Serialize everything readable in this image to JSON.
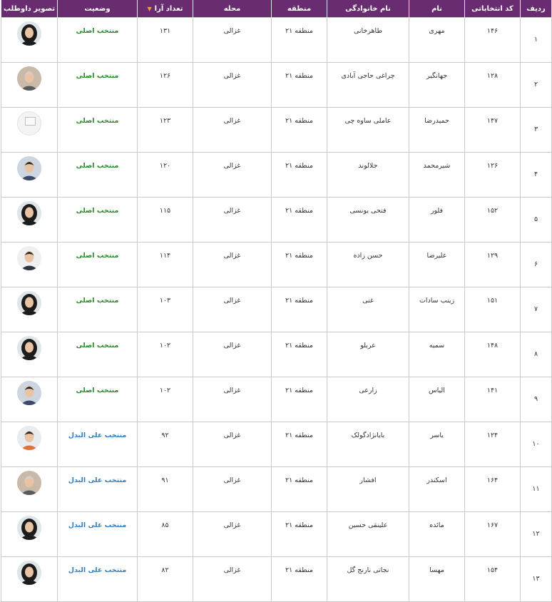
{
  "headers": {
    "radif": "ردیف",
    "code": "کد انتخاباتی",
    "name": "نام",
    "family": "نام خانوادگی",
    "region": "منطقه",
    "mahalle": "محله",
    "votes": "تعداد آرا",
    "status": "وضعیت",
    "photo": "تصویر داوطلب"
  },
  "sort_icon": "sort-down-arrow-icon",
  "colors": {
    "header_bg": "#6a2c70",
    "status_main": "#2b8a2b",
    "status_alt": "#2f7fc2"
  },
  "rows": [
    {
      "radif": "۱",
      "code": "۱۴۶",
      "name": "مهری",
      "family": "طاهرخانی",
      "region": "منطقه ۲۱",
      "mahalle": "غزالی",
      "votes": "۱۳۱",
      "status": "منتخب اصلی",
      "status_type": "main",
      "photo": "woman-hijab-avatar"
    },
    {
      "radif": "۲",
      "code": "۱۲۸",
      "name": "جهانگیر",
      "family": "چراغی حاجی آبادی",
      "region": "منطقه ۲۱",
      "mahalle": "غزالی",
      "votes": "۱۲۶",
      "status": "منتخب اصلی",
      "status_type": "main",
      "photo": "elderly-man-avatar"
    },
    {
      "radif": "۳",
      "code": "۱۴۷",
      "name": "حمیدرضا",
      "family": "عاملی ساوه چی",
      "region": "منطقه ۲۱",
      "mahalle": "غزالی",
      "votes": "۱۲۳",
      "status": "منتخب اصلی",
      "status_type": "main",
      "photo": "no-photo-placeholder"
    },
    {
      "radif": "۴",
      "code": "۱۲۶",
      "name": "شیرمحمد",
      "family": "جلالوند",
      "region": "منطقه ۲۱",
      "mahalle": "غزالی",
      "votes": "۱۲۰",
      "status": "منتخب اصلی",
      "status_type": "main",
      "photo": "man-avatar"
    },
    {
      "radif": "۵",
      "code": "۱۵۲",
      "name": "فلور",
      "family": "فتحی یونسی",
      "region": "منطقه ۲۱",
      "mahalle": "غزالی",
      "votes": "۱۱۵",
      "status": "منتخب اصلی",
      "status_type": "main",
      "photo": "woman-hijab-avatar"
    },
    {
      "radif": "۶",
      "code": "۱۲۹",
      "name": "علیرضا",
      "family": "حسن زاده",
      "region": "منطقه ۲۱",
      "mahalle": "غزالی",
      "votes": "۱۱۴",
      "status": "منتخب اصلی",
      "status_type": "main",
      "photo": "man-suit-avatar"
    },
    {
      "radif": "۷",
      "code": "۱۵۱",
      "name": "زینب سادات",
      "family": "غنی",
      "region": "منطقه ۲۱",
      "mahalle": "غزالی",
      "votes": "۱۰۳",
      "status": "منتخب اصلی",
      "status_type": "main",
      "photo": "woman-scarf-avatar"
    },
    {
      "radif": "۸",
      "code": "۱۴۸",
      "name": "سمیه",
      "family": "عربلو",
      "region": "منطقه ۲۱",
      "mahalle": "غزالی",
      "votes": "۱۰۲",
      "status": "منتخب اصلی",
      "status_type": "main",
      "photo": "woman-chador-avatar"
    },
    {
      "radif": "۹",
      "code": "۱۴۱",
      "name": "الیاس",
      "family": "زارعی",
      "region": "منطقه ۲۱",
      "mahalle": "غزالی",
      "votes": "۱۰۲",
      "status": "منتخب اصلی",
      "status_type": "main",
      "photo": "man-avatar"
    },
    {
      "radif": "۱۰",
      "code": "۱۲۴",
      "name": "یاسر",
      "family": "بایانژادگولک",
      "region": "منطقه ۲۱",
      "mahalle": "غزالی",
      "votes": "۹۲",
      "status": "منتخب علی البدل",
      "status_type": "alt",
      "photo": "man-orange-avatar"
    },
    {
      "radif": "۱۱",
      "code": "۱۶۴",
      "name": "اسکندر",
      "family": "افشار",
      "region": "منطقه ۲۱",
      "mahalle": "غزالی",
      "votes": "۹۱",
      "status": "منتخب علی البدل",
      "status_type": "alt",
      "photo": "older-man-avatar"
    },
    {
      "radif": "۱۲",
      "code": "۱۶۷",
      "name": "مائده",
      "family": "علینقی حسین",
      "region": "منطقه ۲۱",
      "mahalle": "غزالی",
      "votes": "۸۵",
      "status": "منتخب علی البدل",
      "status_type": "alt",
      "photo": "woman-hijab-avatar"
    },
    {
      "radif": "۱۳",
      "code": "۱۵۴",
      "name": "مهسا",
      "family": "نجاتی نارنج گل",
      "region": "منطقه ۲۱",
      "mahalle": "غزالی",
      "votes": "۸۲",
      "status": "منتخب علی البدل",
      "status_type": "alt",
      "photo": "woman-chador-avatar"
    }
  ]
}
